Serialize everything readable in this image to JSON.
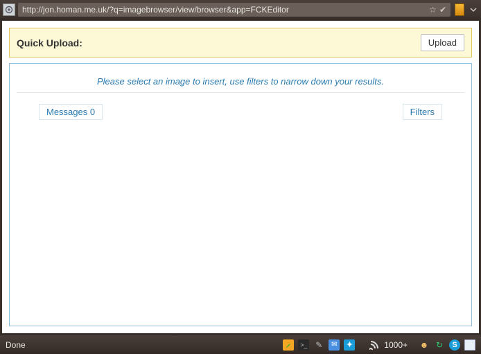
{
  "address_bar": {
    "url": "http://jon.homan.me.uk/?q=imagebrowser/view/browser&app=FCKEditor"
  },
  "quick_upload": {
    "title": "Quick Upload:",
    "button": "Upload"
  },
  "browser": {
    "instruction": "Please select an image to insert, use filters to narrow down your results.",
    "messages_label": "Messages 0",
    "filters_label": "Filters"
  },
  "statusbar": {
    "text": "Done",
    "rss_count": "1000+"
  }
}
